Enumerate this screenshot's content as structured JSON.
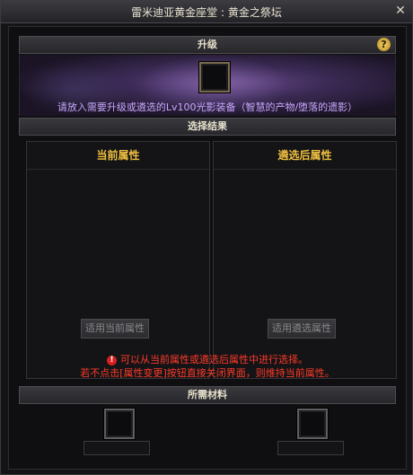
{
  "window": {
    "title": "雷米迪亚黄金座堂 : 黄金之祭坛",
    "close_glyph": "✕"
  },
  "upgrade": {
    "header": "升级",
    "help_glyph": "?",
    "instruction": "请放入需要升级或遴选的Lv100光影装备（智慧的产物/堕落的遗影）"
  },
  "result": {
    "header": "选择结果",
    "current": {
      "header": "当前属性",
      "button": "适用当前属性"
    },
    "selected": {
      "header": "遴选后属性",
      "button": "适用遴选属性"
    },
    "notes": [
      "可以从当前属性或遴选后属性中进行选择。",
      "若不点击[属性变更]按钮直接关闭界面，则维持当前属性。"
    ]
  },
  "materials": {
    "header": "所需材料"
  },
  "colors": {
    "accent_gold": "#f0c040",
    "instruction_purple": "#c9a7ff",
    "warning_red": "#ff3a2a"
  }
}
